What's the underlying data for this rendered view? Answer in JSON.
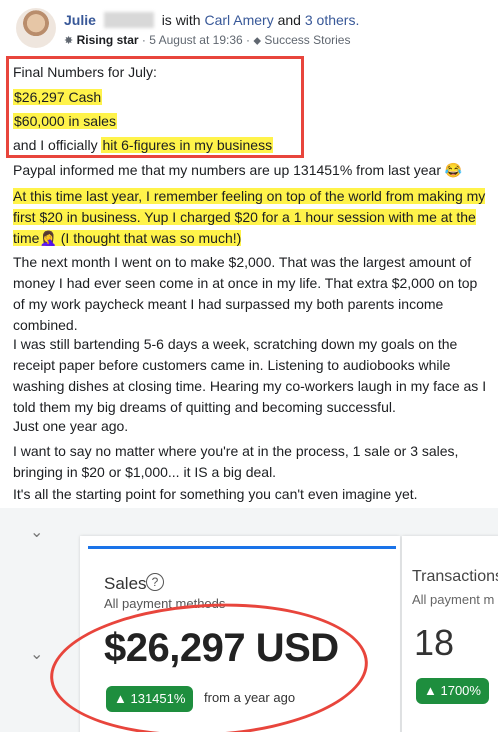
{
  "header": {
    "author": "Julie",
    "with_text": "is with",
    "tagged": "Carl Amery",
    "and_text": "and",
    "others": "3 others.",
    "badge": "Rising star",
    "date": "5 August at 19:36",
    "group_icon": "tag-icon",
    "group": "Success Stories"
  },
  "highlight_box": {
    "line1": "Final Numbers for July:",
    "line2": "$26,297 Cash",
    "line3": "$60,000 in sales",
    "line4_pre": "and I officially ",
    "line4_hl": "hit 6-figures in my business"
  },
  "body": {
    "p1": "Paypal informed me that my numbers are up 131451% from last year 😂",
    "p2": "At this time last year, I remember feeling on top of the world from making my first $20 in business. Yup I charged $20 for a 1 hour session with me at the time🤦‍♀️ (I thought that was so much!)",
    "p3": "The next month I went on to make $2,000. That was the largest amount of money I had ever seen come in at once in my life. That extra $2,000 on top of my work paycheck meant I had surpassed my both parents income combined.",
    "p4": "I was still bartending 5-6 days a week, scratching down my goals on the receipt paper before customers came in. Listening to audiobooks while washing dishes at closing time. Hearing my co-workers laugh in my face as I told them my big dreams of quitting and becoming successful.",
    "p5": "Just one year ago.",
    "p6": "I want to say no matter where you're at in the process, 1 sale or 3 sales, bringing in $20 or $1,000... it IS a big deal.",
    "p7": "It's all the starting point for something you can't even imagine yet."
  },
  "screenshot": {
    "sales_label": "Sales",
    "help": "?",
    "all_payment": "All payment methods",
    "amount": "$26,297 USD",
    "growth": "▲ 131451%",
    "from_year": "from a year ago",
    "transactions": "Transactions",
    "all_payment2": "All payment m",
    "tx_count": "18",
    "tx_growth": "▲ 1700%",
    "accent": "#1e8e3e",
    "annotation_color": "#e8453c"
  }
}
